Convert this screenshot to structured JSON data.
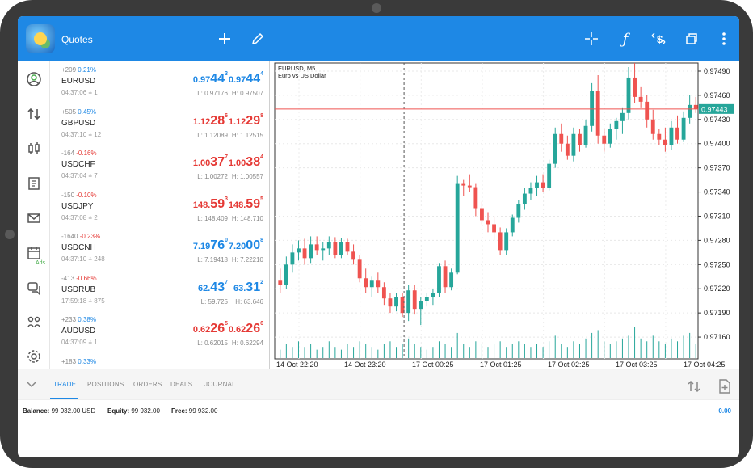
{
  "app": {
    "title": "Quotes"
  },
  "toolbar": {
    "icons": [
      "plus-icon",
      "pencil-icon",
      "crosshair-icon",
      "function-icon",
      "dollar-chart-icon",
      "windows-icon",
      "more-vert-icon"
    ]
  },
  "rail": {
    "ads_label": "Ads"
  },
  "quotes": [
    {
      "change_pts": "+209",
      "change_pct": "0.21%",
      "direction": "up",
      "symbol": "EURUSD",
      "time": "04:37:06",
      "spread": "1",
      "bid_pre": "0.97",
      "bid_big": "44",
      "bid_sup": "3",
      "ask_pre": "0.97",
      "ask_big": "44",
      "ask_sup": "4",
      "low": "L: 0.97176",
      "high": "H: 0.97507",
      "bid_color": "up",
      "ask_color": "up"
    },
    {
      "change_pts": "+505",
      "change_pct": "0.45%",
      "direction": "up",
      "symbol": "GBPUSD",
      "time": "04:37:10",
      "spread": "12",
      "bid_pre": "1.12",
      "bid_big": "28",
      "bid_sup": "6",
      "ask_pre": "1.12",
      "ask_big": "29",
      "ask_sup": "8",
      "low": "L: 1.12089",
      "high": "H: 1.12515",
      "bid_color": "down",
      "ask_color": "down"
    },
    {
      "change_pts": "-164",
      "change_pct": "-0.16%",
      "direction": "down",
      "symbol": "USDCHF",
      "time": "04:37:04",
      "spread": "7",
      "bid_pre": "1.00",
      "bid_big": "37",
      "bid_sup": "7",
      "ask_pre": "1.00",
      "ask_big": "38",
      "ask_sup": "4",
      "low": "L: 1.00272",
      "high": "H: 1.00557",
      "bid_color": "down",
      "ask_color": "down"
    },
    {
      "change_pts": "-150",
      "change_pct": "-0.10%",
      "direction": "down",
      "symbol": "USDJPY",
      "time": "04:37:08",
      "spread": "2",
      "bid_pre": "148.",
      "bid_big": "59",
      "bid_sup": "3",
      "ask_pre": "148.",
      "ask_big": "59",
      "ask_sup": "5",
      "low": "L: 148.409",
      "high": "H: 148.710",
      "bid_color": "down",
      "ask_color": "down"
    },
    {
      "change_pts": "-1640",
      "change_pct": "-0.23%",
      "direction": "down",
      "symbol": "USDCNH",
      "time": "04:37:10",
      "spread": "248",
      "bid_pre": "7.19",
      "bid_big": "76",
      "bid_sup": "0",
      "ask_pre": "7.20",
      "ask_big": "00",
      "ask_sup": "8",
      "low": "L: 7.19418",
      "high": "H: 7.22210",
      "bid_color": "up",
      "ask_color": "up"
    },
    {
      "change_pts": "-413",
      "change_pct": "-0.66%",
      "direction": "down",
      "symbol": "USDRUB",
      "time": "17:59:18",
      "spread": "875",
      "bid_pre": "62.",
      "bid_big": "43",
      "bid_sup": "7",
      "ask_pre": "63.",
      "ask_big": "31",
      "ask_sup": "2",
      "low": "L: 59.725",
      "high": "H: 63.646",
      "bid_color": "up",
      "ask_color": "up"
    },
    {
      "change_pts": "+233",
      "change_pct": "0.38%",
      "direction": "up",
      "symbol": "AUDUSD",
      "time": "04:37:09",
      "spread": "1",
      "bid_pre": "0.62",
      "bid_big": "26",
      "bid_sup": "5",
      "ask_pre": "0.62",
      "ask_big": "26",
      "ask_sup": "6",
      "low": "L: 0.62015",
      "high": "H: 0.62294",
      "bid_color": "down",
      "ask_color": "down"
    },
    {
      "change_pts": "+183",
      "change_pct": "0.33%",
      "direction": "up",
      "symbol": "",
      "time": "",
      "spread": "",
      "bid_pre": "",
      "bid_big": "",
      "bid_sup": "",
      "ask_pre": "",
      "ask_big": "",
      "ask_sup": "",
      "low": "",
      "high": "",
      "bid_color": "down",
      "ask_color": "down"
    }
  ],
  "chart": {
    "symbol_line": "EURUSD, M5",
    "description": "Euro vs US Dollar",
    "current_price": "0.97443",
    "colors": {
      "bull": "#26a69a",
      "bear": "#ef5350",
      "price_line": "#ef5350",
      "price_tag": "#26a69a"
    }
  },
  "chart_data": {
    "type": "candlestick",
    "title": "EURUSD, M5",
    "subtitle": "Euro vs US Dollar",
    "y_ticks": [
      "0.97490",
      "0.97460",
      "0.97430",
      "0.97400",
      "0.97370",
      "0.97340",
      "0.97310",
      "0.97280",
      "0.97250",
      "0.97220",
      "0.97190",
      "0.97160"
    ],
    "x_ticks": [
      "14 Oct 22:20",
      "14 Oct 23:20",
      "17 Oct 00:25",
      "17 Oct 01:25",
      "17 Oct 02:25",
      "17 Oct 03:25",
      "17 Oct 04:25"
    ],
    "ylim": [
      0.97135,
      0.975
    ],
    "candles": [
      [
        0.9723,
        0.97245,
        0.97215,
        0.97225
      ],
      [
        0.97225,
        0.9726,
        0.9722,
        0.9725
      ],
      [
        0.9725,
        0.97275,
        0.9724,
        0.97265
      ],
      [
        0.97265,
        0.9728,
        0.97255,
        0.9727
      ],
      [
        0.9727,
        0.97282,
        0.9725,
        0.97258
      ],
      [
        0.97258,
        0.97285,
        0.97252,
        0.97275
      ],
      [
        0.97275,
        0.97285,
        0.97262,
        0.97268
      ],
      [
        0.97268,
        0.97278,
        0.97255,
        0.9727
      ],
      [
        0.9727,
        0.97285,
        0.97262,
        0.97278
      ],
      [
        0.97278,
        0.97284,
        0.97258,
        0.97262
      ],
      [
        0.97262,
        0.97283,
        0.97258,
        0.97278
      ],
      [
        0.97278,
        0.97282,
        0.97262,
        0.97266
      ],
      [
        0.97266,
        0.97275,
        0.9725,
        0.97256
      ],
      [
        0.97256,
        0.97262,
        0.97228,
        0.97233
      ],
      [
        0.97233,
        0.97245,
        0.97215,
        0.97222
      ],
      [
        0.97222,
        0.97235,
        0.9721,
        0.9723
      ],
      [
        0.9723,
        0.9724,
        0.97215,
        0.97222
      ],
      [
        0.97222,
        0.97228,
        0.972,
        0.97208
      ],
      [
        0.97208,
        0.97215,
        0.9719,
        0.97198
      ],
      [
        0.97198,
        0.97215,
        0.97192,
        0.9721
      ],
      [
        0.9721,
        0.97215,
        0.97185,
        0.9719
      ],
      [
        0.9719,
        0.97225,
        0.9718,
        0.97218
      ],
      [
        0.97218,
        0.97225,
        0.97188,
        0.97195
      ],
      [
        0.97195,
        0.9721,
        0.97175,
        0.97205
      ],
      [
        0.97205,
        0.97215,
        0.97198,
        0.9721
      ],
      [
        0.9721,
        0.9722,
        0.972,
        0.97215
      ],
      [
        0.97215,
        0.97252,
        0.9721,
        0.97248
      ],
      [
        0.97248,
        0.97255,
        0.97215,
        0.97222
      ],
      [
        0.97222,
        0.97245,
        0.97218,
        0.9724
      ],
      [
        0.9724,
        0.9736,
        0.97238,
        0.9735
      ],
      [
        0.9735,
        0.97355,
        0.97335,
        0.97348
      ],
      [
        0.97348,
        0.97362,
        0.9734,
        0.97346
      ],
      [
        0.97346,
        0.9735,
        0.9731,
        0.9732
      ],
      [
        0.9732,
        0.97328,
        0.973,
        0.97305
      ],
      [
        0.97305,
        0.97315,
        0.9729,
        0.973
      ],
      [
        0.973,
        0.9731,
        0.9728,
        0.9729
      ],
      [
        0.9729,
        0.97296,
        0.97262,
        0.97268
      ],
      [
        0.97268,
        0.97295,
        0.97262,
        0.9729
      ],
      [
        0.9729,
        0.97312,
        0.97285,
        0.97308
      ],
      [
        0.97308,
        0.9733,
        0.97302,
        0.97325
      ],
      [
        0.97325,
        0.97345,
        0.97318,
        0.97338
      ],
      [
        0.97338,
        0.97352,
        0.9733,
        0.97345
      ],
      [
        0.97345,
        0.9736,
        0.97335,
        0.97352
      ],
      [
        0.97352,
        0.97362,
        0.9734,
        0.97345
      ],
      [
        0.97345,
        0.9738,
        0.97342,
        0.97375
      ],
      [
        0.97375,
        0.9742,
        0.9737,
        0.97412
      ],
      [
        0.97412,
        0.97425,
        0.9739,
        0.974
      ],
      [
        0.974,
        0.9741,
        0.9738,
        0.97385
      ],
      [
        0.97385,
        0.9742,
        0.97378,
        0.97412
      ],
      [
        0.97412,
        0.97418,
        0.9739,
        0.97398
      ],
      [
        0.97398,
        0.9743,
        0.97395,
        0.97422
      ],
      [
        0.97422,
        0.97475,
        0.97415,
        0.97465
      ],
      [
        0.97465,
        0.97485,
        0.974,
        0.9741
      ],
      [
        0.9741,
        0.97418,
        0.9739,
        0.974
      ],
      [
        0.974,
        0.97425,
        0.97395,
        0.97418
      ],
      [
        0.97418,
        0.97432,
        0.97405,
        0.97428
      ],
      [
        0.97428,
        0.97445,
        0.97412,
        0.97438
      ],
      [
        0.97438,
        0.97495,
        0.9743,
        0.97482
      ],
      [
        0.97482,
        0.975,
        0.9745,
        0.97458
      ],
      [
        0.97458,
        0.9747,
        0.97445,
        0.97452
      ],
      [
        0.97452,
        0.9746,
        0.9742,
        0.9743
      ],
      [
        0.9743,
        0.97442,
        0.97405,
        0.97412
      ],
      [
        0.97412,
        0.97418,
        0.97398,
        0.97405
      ],
      [
        0.97405,
        0.9742,
        0.9739,
        0.97398
      ],
      [
        0.97398,
        0.97428,
        0.97392,
        0.9742
      ],
      [
        0.9742,
        0.97435,
        0.974,
        0.97405
      ],
      [
        0.97405,
        0.9744,
        0.97402,
        0.97432
      ],
      [
        0.97432,
        0.9746,
        0.97425,
        0.97448
      ],
      [
        0.97448,
        0.97458,
        0.97438,
        0.97443
      ]
    ],
    "volumes": [
      3,
      5,
      4,
      6,
      4,
      5,
      3,
      4,
      6,
      4,
      3,
      5,
      4,
      6,
      5,
      4,
      3,
      5,
      6,
      4,
      5,
      7,
      5,
      4,
      3,
      4,
      6,
      5,
      4,
      9,
      5,
      4,
      6,
      5,
      4,
      5,
      6,
      4,
      5,
      6,
      5,
      4,
      5,
      4,
      6,
      8,
      5,
      4,
      6,
      5,
      7,
      9,
      10,
      6,
      5,
      6,
      7,
      8,
      11,
      7,
      6,
      8,
      6,
      5,
      7,
      6,
      8,
      9,
      5
    ],
    "current_price": 0.97443,
    "price_line_y": 0.97443,
    "crosshair_index": 20
  },
  "tabs": {
    "items": [
      "TRADE",
      "POSITIONS",
      "ORDERS",
      "DEALS",
      "JOURNAL"
    ]
  },
  "account": {
    "balance_label": "Balance:",
    "balance_value": "99 932.00 USD",
    "equity_label": "Equity:",
    "equity_value": "99 932.00",
    "free_label": "Free:",
    "free_value": "99 932.00",
    "profit": "0.00"
  }
}
